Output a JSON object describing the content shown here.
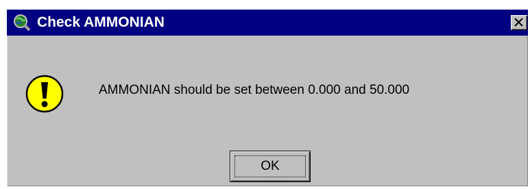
{
  "dialog": {
    "title": "Check AMMONIAN",
    "icon": "globe-magnifier-icon",
    "close_label": "×",
    "message": "AMMONIAN should be set between 0.000 and 50.000",
    "message_icon": "exclamation-warning-icon",
    "ok_label": "OK"
  },
  "colors": {
    "titlebar": "#000080",
    "dialog_bg": "#c0c0c0",
    "warning_fill": "#ffff00"
  }
}
